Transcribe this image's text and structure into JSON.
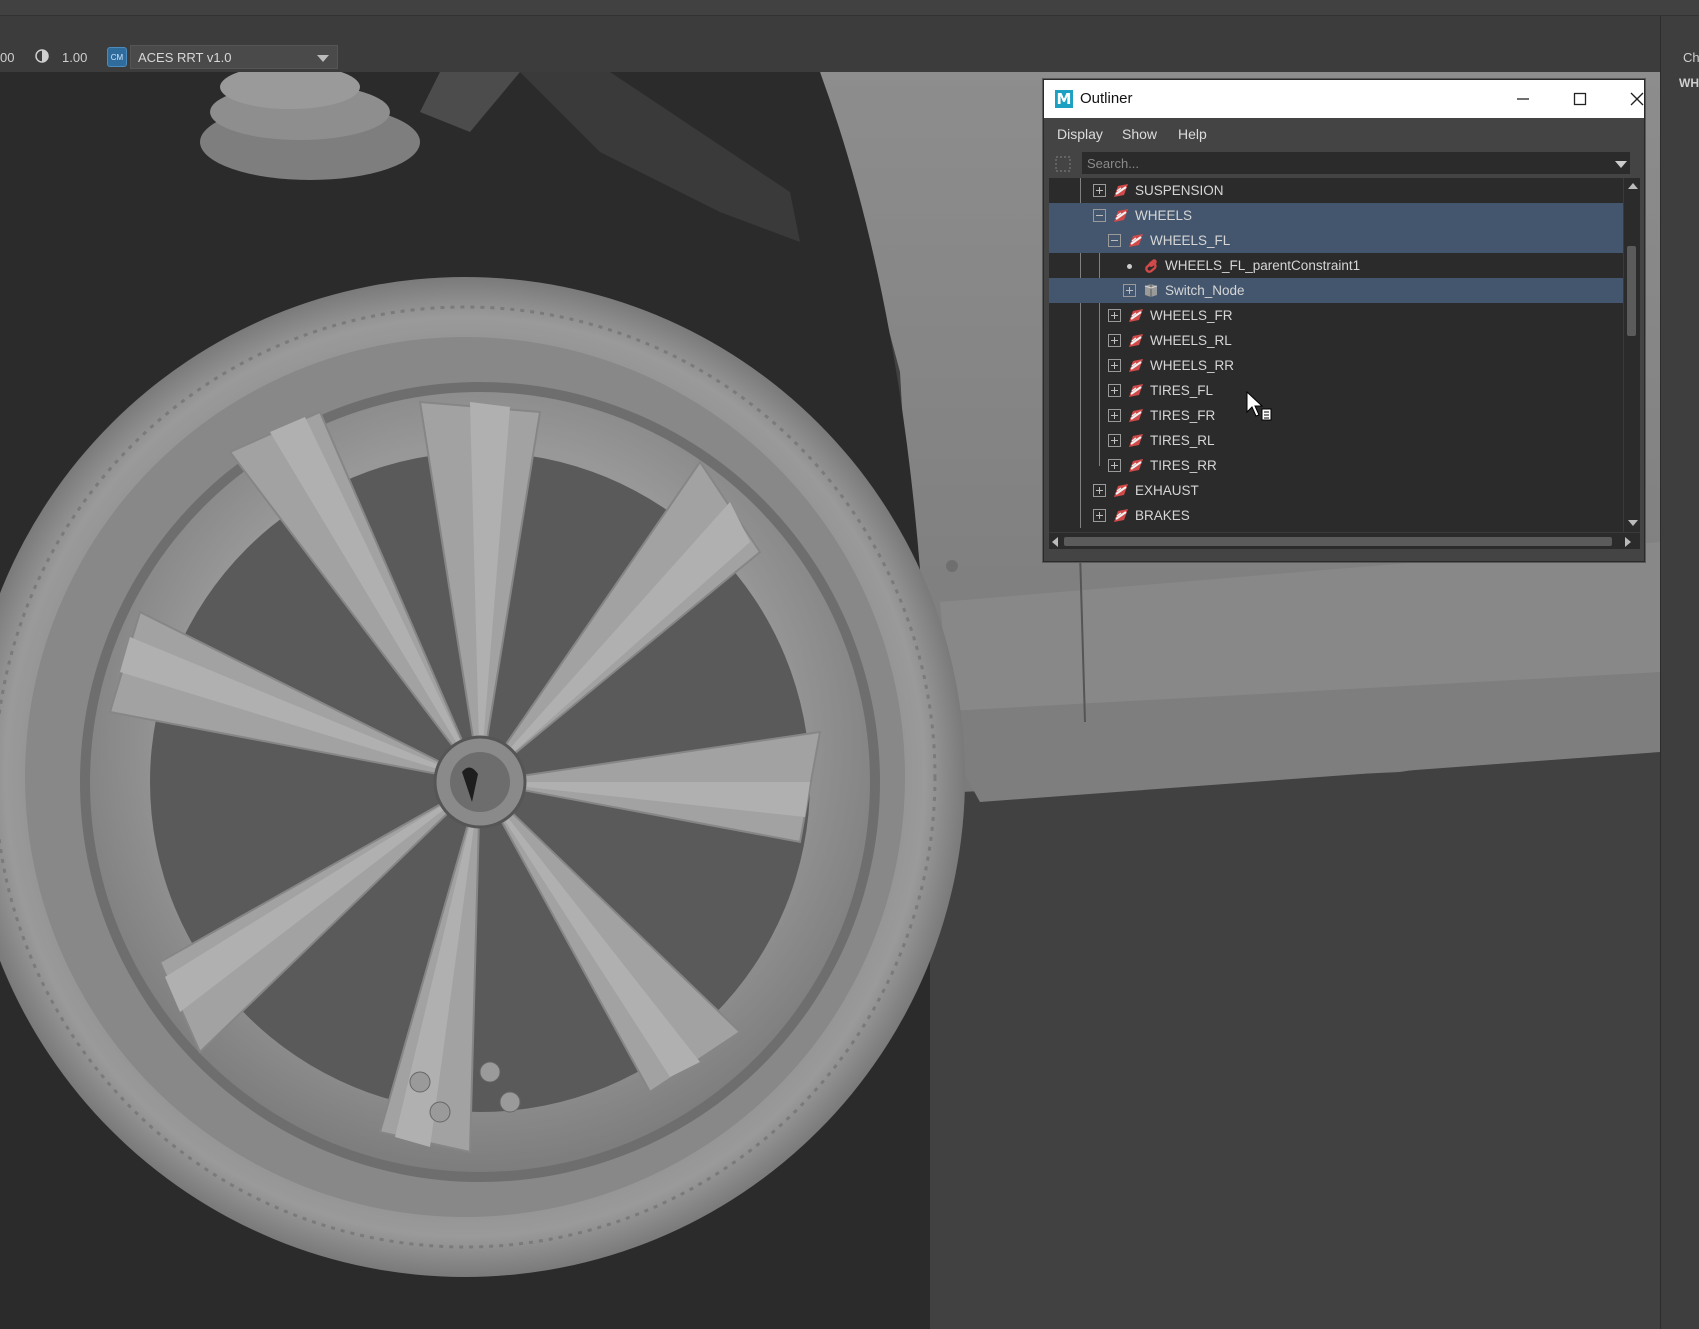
{
  "toolbar": {
    "value_1": "00",
    "value_2": "1.00",
    "color_management_icon": "cm-badge-icon",
    "view_transform": "ACES RRT v1.0"
  },
  "right_panel": {
    "label_1": "Ch",
    "label_2": "WH"
  },
  "outliner": {
    "title": "Outliner",
    "app_icon_letter": "M",
    "menus": [
      "Display",
      "Show",
      "Help"
    ],
    "search_placeholder": "Search...",
    "tree": [
      {
        "label": "SUSPENSION",
        "depth": 1,
        "expander": "plus",
        "icon": "transform-icon",
        "selected": false
      },
      {
        "label": "WHEELS",
        "depth": 1,
        "expander": "minus",
        "icon": "transform-icon",
        "selected": true
      },
      {
        "label": "WHEELS_FL",
        "depth": 2,
        "expander": "minus",
        "icon": "transform-icon",
        "selected": true
      },
      {
        "label": "WHEELS_FL_parentConstraint1",
        "depth": 3,
        "expander": "none",
        "icon": "constraint-icon",
        "selected": false
      },
      {
        "label": "Switch_Node",
        "depth": 3,
        "expander": "plus",
        "icon": "switch-node-icon",
        "selected": true
      },
      {
        "label": "WHEELS_FR",
        "depth": 2,
        "expander": "plus",
        "icon": "transform-icon",
        "selected": false
      },
      {
        "label": "WHEELS_RL",
        "depth": 2,
        "expander": "plus",
        "icon": "transform-icon",
        "selected": false
      },
      {
        "label": "WHEELS_RR",
        "depth": 2,
        "expander": "plus",
        "icon": "transform-icon",
        "selected": false
      },
      {
        "label": "TIRES_FL",
        "depth": 2,
        "expander": "plus",
        "icon": "transform-icon",
        "selected": false
      },
      {
        "label": "TIRES_FR",
        "depth": 2,
        "expander": "plus",
        "icon": "transform-icon",
        "selected": false
      },
      {
        "label": "TIRES_RL",
        "depth": 2,
        "expander": "plus",
        "icon": "transform-icon",
        "selected": false
      },
      {
        "label": "TIRES_RR",
        "depth": 2,
        "expander": "plus",
        "icon": "transform-icon",
        "selected": false
      },
      {
        "label": "EXHAUST",
        "depth": 1,
        "expander": "plus",
        "icon": "transform-icon",
        "selected": false
      },
      {
        "label": "BRAKES",
        "depth": 1,
        "expander": "plus",
        "icon": "transform-icon",
        "selected": false
      }
    ]
  },
  "colors": {
    "selection": "#43566e",
    "tree_bg": "#2b2b2b",
    "viewport_bg": "#414141",
    "transform_icon": "#d04a4a"
  }
}
